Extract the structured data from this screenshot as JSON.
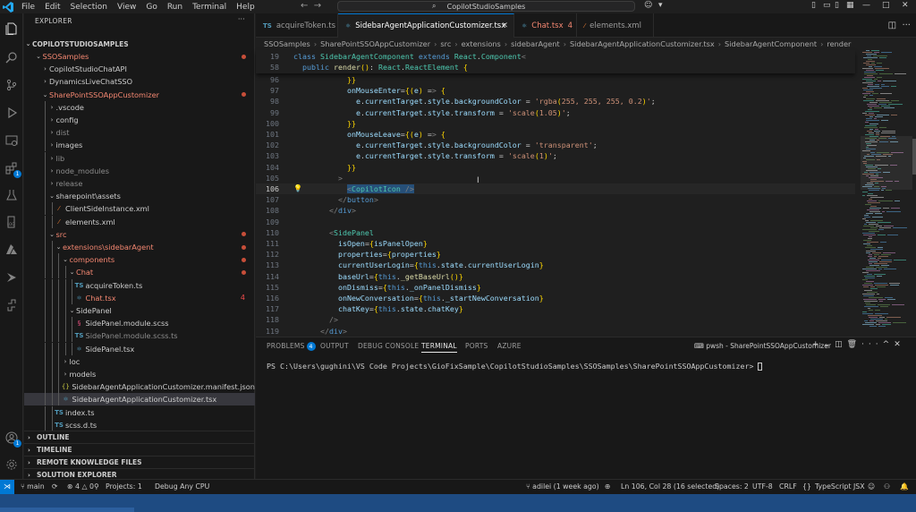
{
  "titlebar": {
    "menus": [
      "File",
      "Edit",
      "Selection",
      "View",
      "Go",
      "Run",
      "Terminal",
      "Help"
    ],
    "search_text": "CopilotStudioSamples"
  },
  "sidebar": {
    "title": "EXPLORER",
    "root": "COPILOTSTUDIOSAMPLES",
    "tree": [
      {
        "label": "SSOSamples",
        "depth": 1,
        "type": "folder-open",
        "color": "red",
        "dot": true
      },
      {
        "label": "CopilotStudioChatAPI",
        "depth": 2,
        "type": "folder"
      },
      {
        "label": "DynamicsLiveChatSSO",
        "depth": 2,
        "type": "folder"
      },
      {
        "label": "SharePointSSOAppCustomizer",
        "depth": 2,
        "type": "folder-open",
        "color": "red",
        "dot": true
      },
      {
        "label": ".vscode",
        "depth": 3,
        "type": "folder"
      },
      {
        "label": "config",
        "depth": 3,
        "type": "folder"
      },
      {
        "label": "dist",
        "depth": 3,
        "type": "folder",
        "color": "dim"
      },
      {
        "label": "images",
        "depth": 3,
        "type": "folder"
      },
      {
        "label": "lib",
        "depth": 3,
        "type": "folder",
        "color": "dim"
      },
      {
        "label": "node_modules",
        "depth": 3,
        "type": "folder",
        "color": "dim"
      },
      {
        "label": "release",
        "depth": 3,
        "type": "folder",
        "color": "dim"
      },
      {
        "label": "sharepoint\\assets",
        "depth": 3,
        "type": "folder-open"
      },
      {
        "label": "ClientSideInstance.xml",
        "depth": 4,
        "type": "xml"
      },
      {
        "label": "elements.xml",
        "depth": 4,
        "type": "xml"
      },
      {
        "label": "src",
        "depth": 3,
        "type": "folder-open",
        "color": "red",
        "dot": true
      },
      {
        "label": "extensions\\sidebarAgent",
        "depth": 4,
        "type": "folder-open",
        "color": "red",
        "dot": true
      },
      {
        "label": "components",
        "depth": 5,
        "type": "folder-open",
        "color": "red",
        "dot": true
      },
      {
        "label": "Chat",
        "depth": 6,
        "type": "folder-open",
        "color": "red",
        "dot": true
      },
      {
        "label": "acquireToken.ts",
        "depth": 7,
        "type": "ts"
      },
      {
        "label": "Chat.tsx",
        "depth": 7,
        "type": "tsx",
        "color": "red",
        "count": "4"
      },
      {
        "label": "SidePanel",
        "depth": 6,
        "type": "folder-open"
      },
      {
        "label": "SidePanel.module.scss",
        "depth": 7,
        "type": "scss"
      },
      {
        "label": "SidePanel.module.scss.ts",
        "depth": 7,
        "type": "ts",
        "color": "dim"
      },
      {
        "label": "SidePanel.tsx",
        "depth": 7,
        "type": "tsx"
      },
      {
        "label": "loc",
        "depth": 5,
        "type": "folder"
      },
      {
        "label": "models",
        "depth": 5,
        "type": "folder"
      },
      {
        "label": "SidebarAgentApplicationCustomizer.manifest.json",
        "depth": 5,
        "type": "json"
      },
      {
        "label": "SidebarAgentApplicationCustomizer.tsx",
        "depth": 5,
        "type": "tsx",
        "selected": true
      },
      {
        "label": "index.ts",
        "depth": 4,
        "type": "ts"
      },
      {
        "label": "scss.d.ts",
        "depth": 4,
        "type": "ts"
      }
    ],
    "sections": [
      "OUTLINE",
      "TIMELINE",
      "REMOTE KNOWLEDGE FILES",
      "SOLUTION EXPLORER"
    ]
  },
  "tabs": [
    {
      "label": "acquireToken.ts",
      "icon": "TS"
    },
    {
      "label": "SidebarAgentApplicationCustomizer.tsx",
      "icon": "⚛",
      "active": true
    },
    {
      "label": "Chat.tsx",
      "icon": "⚛",
      "count": "4"
    },
    {
      "label": "elements.xml",
      "icon": "⁄"
    }
  ],
  "breadcrumb": [
    "SSOSamples",
    "SharePointSSOAppCustomizer",
    "src",
    "extensions",
    "sidebarAgent",
    "SidebarAgentApplicationCustomizer.tsx",
    "SidebarAgentComponent",
    "render"
  ],
  "sticky": [
    {
      "ln": "19",
      "code": "class SidebarAgentComponent extends React.Component<"
    },
    {
      "ln": "58",
      "code": "  public render(): React.ReactElement {"
    }
  ],
  "code": [
    {
      "ln": "96",
      "code": "            }}"
    },
    {
      "ln": "97",
      "code": "            onMouseEnter={(e) => {"
    },
    {
      "ln": "98",
      "code": "              e.currentTarget.style.backgroundColor = 'rgba(255, 255, 255, 0.2)';"
    },
    {
      "ln": "99",
      "code": "              e.currentTarget.style.transform = 'scale(1.05)';"
    },
    {
      "ln": "100",
      "code": "            }}"
    },
    {
      "ln": "101",
      "code": "            onMouseLeave={(e) => {"
    },
    {
      "ln": "102",
      "code": "              e.currentTarget.style.backgroundColor = 'transparent';"
    },
    {
      "ln": "103",
      "code": "              e.currentTarget.style.transform = 'scale(1)';"
    },
    {
      "ln": "104",
      "code": "            }}"
    },
    {
      "ln": "105",
      "code": "          >"
    },
    {
      "ln": "106",
      "code": "            <CopilotIcon />",
      "current": true
    },
    {
      "ln": "107",
      "code": "          </button>"
    },
    {
      "ln": "108",
      "code": "        </div>"
    },
    {
      "ln": "109",
      "code": ""
    },
    {
      "ln": "110",
      "code": "        <SidePanel"
    },
    {
      "ln": "111",
      "code": "          isOpen={isPanelOpen}"
    },
    {
      "ln": "112",
      "code": "          properties={properties}"
    },
    {
      "ln": "113",
      "code": "          currentUserLogin={this.state.currentUserLogin}"
    },
    {
      "ln": "114",
      "code": "          baseUrl={this._getBaseUrl()}"
    },
    {
      "ln": "115",
      "code": "          onDismiss={this._onPanelDismiss}"
    },
    {
      "ln": "116",
      "code": "          onNewConversation={this._startNewConversation}"
    },
    {
      "ln": "117",
      "code": "          chatKey={this.state.chatKey}"
    },
    {
      "ln": "118",
      "code": "        />"
    },
    {
      "ln": "119",
      "code": "      </div>"
    }
  ],
  "panel": {
    "tabs": [
      "PROBLEMS",
      "OUTPUT",
      "DEBUG CONSOLE",
      "TERMINAL",
      "PORTS",
      "AZURE"
    ],
    "problems_count": "4",
    "active_tab": "TERMINAL",
    "terminal_name": "pwsh - SharePointSSOAppCustomizer",
    "prompt": "PS C:\\Users\\gughini\\VS Code Projects\\GioFixSample\\CopilotStudioSamples\\SSOSamples\\SharePointSSOAppCustomizer> "
  },
  "statusbar": {
    "branch": "main",
    "errors": "4",
    "warnings": "0",
    "projects": "Projects: 1",
    "debug": "Debug Any CPU",
    "blame": "adilei (1 week ago)",
    "position": "Ln 106, Col 28 (16 selected)",
    "spaces": "Spaces: 2",
    "encoding": "UTF-8",
    "eol": "CRLF",
    "language": "TypeScript JSX"
  },
  "colors": {
    "accent": "#0078d4",
    "modified": "#f48771",
    "background": "#1f1f1f"
  }
}
